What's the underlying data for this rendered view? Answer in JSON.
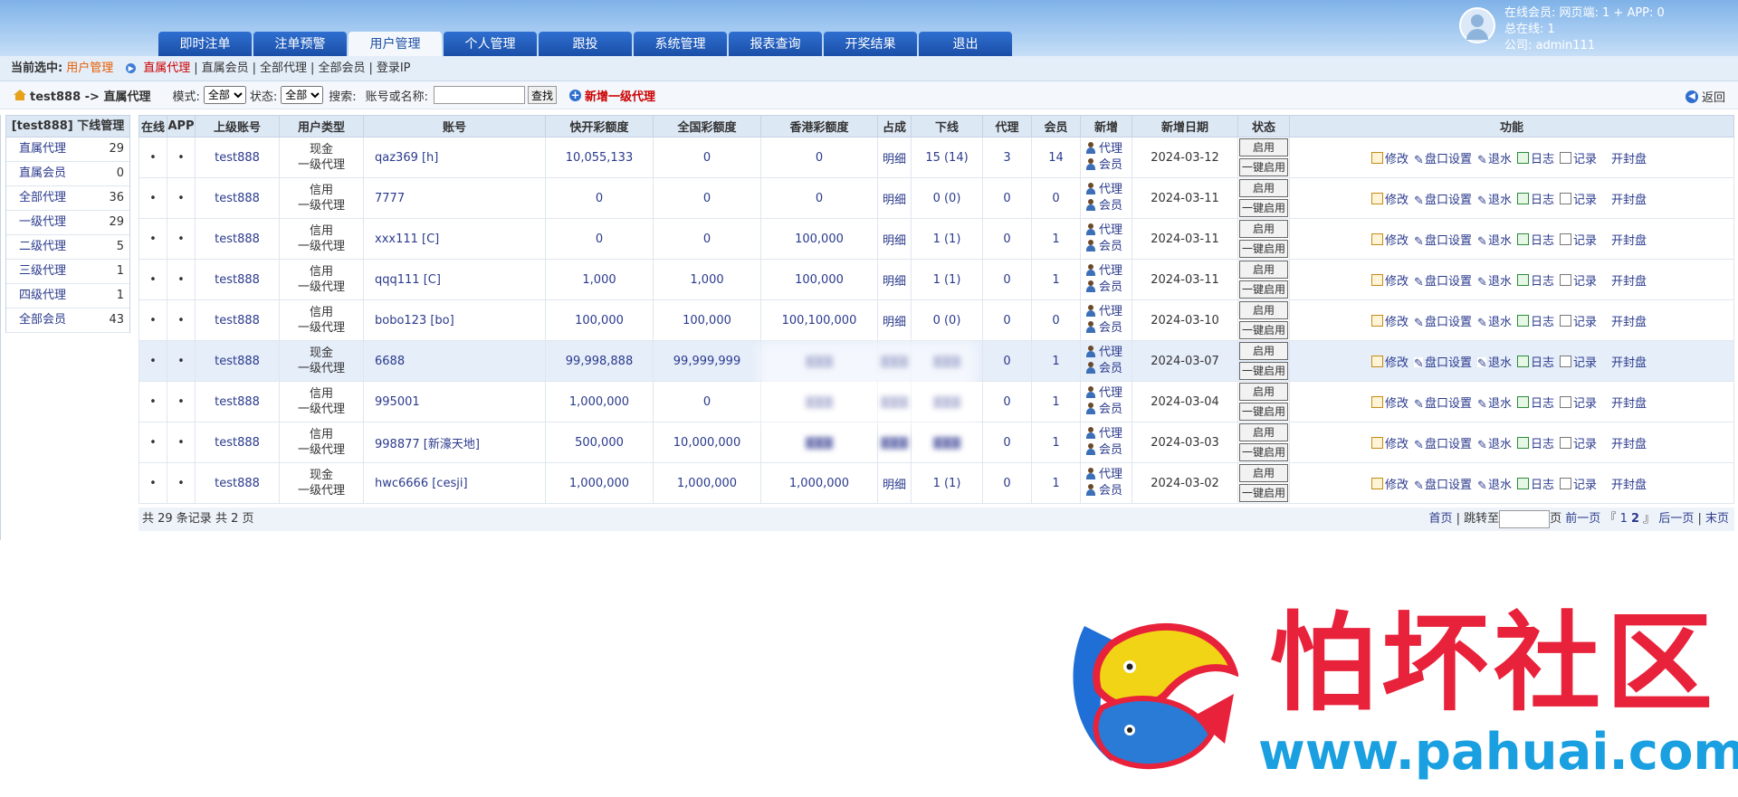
{
  "nav": {
    "tabs": [
      "即时注单",
      "注单预警",
      "用户管理",
      "个人管理",
      "跟投",
      "系统管理",
      "报表查询",
      "开奖结果",
      "退出"
    ],
    "active": "用户管理"
  },
  "user": {
    "online": "在线会员:   网页端: 1 + APP: 0",
    "total": "总在线: 1",
    "company": "公司: admin111"
  },
  "breadcrumb": {
    "label": "当前选中:",
    "section": "用户管理",
    "current": "直属代理",
    "links": [
      "直属会员",
      "全部代理",
      "全部会员",
      "登录IP"
    ]
  },
  "filter": {
    "path": "test888 -> 直属代理",
    "mode_label": "模式:",
    "mode_value": "全部",
    "status_label": "状态:",
    "status_value": "全部",
    "search_label": "搜索:",
    "account_label": "账号或名称:",
    "search_button": "查找",
    "add_agent": "新增一级代理",
    "back": "返回"
  },
  "sidebar": {
    "title": "[test888] 下线管理",
    "items": [
      {
        "label": "直属代理",
        "count": "29"
      },
      {
        "label": "直属会员",
        "count": "0"
      },
      {
        "label": "全部代理",
        "count": "36"
      },
      {
        "label": "一级代理",
        "count": "29"
      },
      {
        "label": "二级代理",
        "count": "5"
      },
      {
        "label": "三级代理",
        "count": "1"
      },
      {
        "label": "四级代理",
        "count": "1"
      },
      {
        "label": "全部会员",
        "count": "43"
      }
    ]
  },
  "table": {
    "headers": [
      "在线",
      "APP",
      "上级账号",
      "用户类型",
      "账号",
      "快开彩额度",
      "全国彩额度",
      "香港彩额度",
      "占成",
      "下线",
      "代理",
      "会员",
      "新增",
      "新增日期",
      "状态",
      "功能"
    ],
    "add_agent": "代理",
    "add_member": "会员",
    "status_buttons": [
      "启用",
      "一键启用"
    ],
    "functions": [
      "修改",
      "盘口设置",
      "退水",
      "日志",
      "记录",
      "开封盘"
    ],
    "rows": [
      {
        "online": "•",
        "app": "•",
        "parent": "test888",
        "type1": "现金",
        "type2": "一级代理",
        "account": "qaz369 [h]",
        "kk": "10,055,133",
        "qg": "0",
        "hk": "0",
        "share": "明细",
        "down": "15 (14)",
        "agents": "3",
        "members": "14",
        "date": "2024-03-12"
      },
      {
        "online": "•",
        "app": "•",
        "parent": "test888",
        "type1": "信用",
        "type2": "一级代理",
        "account": "7777",
        "kk": "0",
        "qg": "0",
        "hk": "0",
        "share": "明细",
        "down": "0 (0)",
        "agents": "0",
        "members": "0",
        "date": "2024-03-11"
      },
      {
        "online": "•",
        "app": "•",
        "parent": "test888",
        "type1": "信用",
        "type2": "一级代理",
        "account": "xxx111 [C]",
        "kk": "0",
        "qg": "0",
        "hk": "100,000",
        "share": "明细",
        "down": "1 (1)",
        "agents": "0",
        "members": "1",
        "date": "2024-03-11"
      },
      {
        "online": "•",
        "app": "•",
        "parent": "test888",
        "type1": "信用",
        "type2": "一级代理",
        "account": "qqq111 [C]",
        "kk": "1,000",
        "qg": "1,000",
        "hk": "100,000",
        "share": "明细",
        "down": "1 (1)",
        "agents": "0",
        "members": "1",
        "date": "2024-03-11"
      },
      {
        "online": "•",
        "app": "•",
        "parent": "test888",
        "type1": "信用",
        "type2": "一级代理",
        "account": "bobo123 [bo]",
        "kk": "100,000",
        "qg": "100,000",
        "hk": "100,100,000",
        "share": "明细",
        "down": "0 (0)",
        "agents": "0",
        "members": "0",
        "date": "2024-03-10"
      },
      {
        "online": "•",
        "app": "•",
        "parent": "test888",
        "type1": "现金",
        "type2": "一级代理",
        "account": "6688",
        "kk": "99,998,888",
        "qg": "99,999,999",
        "hk": "",
        "share": "",
        "down": "",
        "agents": "0",
        "members": "1",
        "date": "2024-03-07"
      },
      {
        "online": "•",
        "app": "•",
        "parent": "test888",
        "type1": "信用",
        "type2": "一级代理",
        "account": "995001",
        "kk": "1,000,000",
        "qg": "0",
        "hk": "",
        "share": "",
        "down": "",
        "agents": "0",
        "members": "1",
        "date": "2024-03-04"
      },
      {
        "online": "•",
        "app": "•",
        "parent": "test888",
        "type1": "信用",
        "type2": "一级代理",
        "account": "998877 [新濠天地]",
        "kk": "500,000",
        "qg": "10,000,000",
        "hk": "",
        "share": "",
        "down": "",
        "agents": "0",
        "members": "1",
        "date": "2024-03-03"
      },
      {
        "online": "•",
        "app": "•",
        "parent": "test888",
        "type1": "现金",
        "type2": "一级代理",
        "account": "hwc6666 [cesji]",
        "kk": "1,000,000",
        "qg": "1,000,000",
        "hk": "1,000,000",
        "share": "明细",
        "down": "1 (1)",
        "agents": "0",
        "members": "1",
        "date": "2024-03-02"
      }
    ]
  },
  "footer": {
    "summary": "共 29 条记录 共 2 页",
    "first": "首页",
    "jump": "跳转至",
    "page_unit": "页",
    "prev": "前一页",
    "page1": "1",
    "page2": "2",
    "next": "后一页",
    "last": "末页"
  },
  "watermark": {
    "text": "怕坏社区",
    "url": "www.pahuai.com"
  }
}
